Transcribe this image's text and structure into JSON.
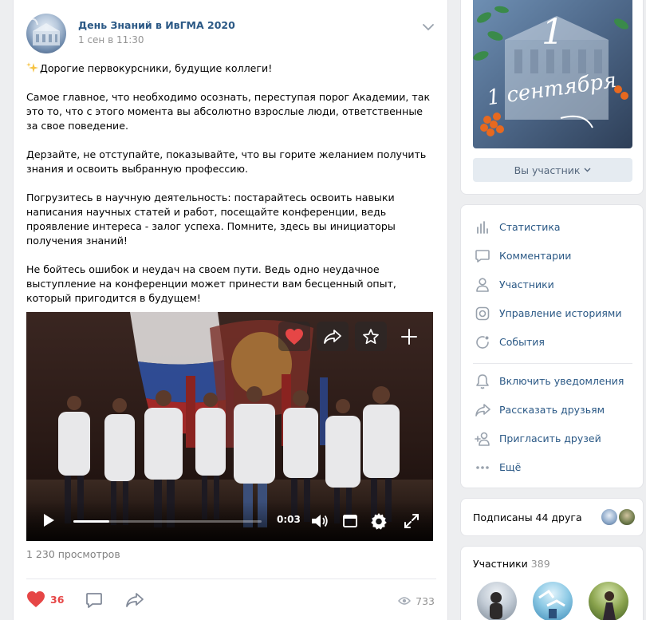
{
  "post": {
    "author": "День Знаний в ИвГМА 2020",
    "date": "1 сен в 11:30",
    "paragraphs": [
      "Дорогие первокурсники, будущие коллеги!",
      "Самое главное, что необходимо осознать, переступая порог Академии, так это то, что с этого момента вы абсолютно взрослые люди, ответственные за свое поведение.",
      "Дерзайте, не отступайте, показывайте, что вы горите желанием получить знания и освоить выбранную профессию.",
      "Погрузитесь в научную деятельность: постарайтесь освоить навыки написания научных статей и работ, посещайте конференции, ведь проявление интереса - залог успеха. Помните, здесь вы инициаторы получения знаний!",
      "Не бойтесь ошибок и неудач на своем пути. Ведь одно неудачное выступление на конференции может принести вам бесценный опыт, который пригодится в будущем!"
    ],
    "video": {
      "time": "0:03",
      "progress_fraction": 0.19
    },
    "views_label": "1 230 просмотров",
    "likes": "36",
    "views": "733",
    "colors": {
      "like": "#e64646",
      "link": "#2a5885"
    }
  },
  "sidebar": {
    "cover_text": "1 сентября",
    "member_button": "Вы участник",
    "menu": [
      {
        "label": "Статистика",
        "icon": "stats-icon"
      },
      {
        "label": "Комментарии",
        "icon": "comment-icon"
      },
      {
        "label": "Участники",
        "icon": "user-icon"
      },
      {
        "label": "Управление историями",
        "icon": "stories-icon"
      },
      {
        "label": "События",
        "icon": "event-icon"
      },
      {
        "label": "Включить уведомления",
        "icon": "bell-icon"
      },
      {
        "label": "Рассказать друзьям",
        "icon": "share-icon"
      },
      {
        "label": "Пригласить друзей",
        "icon": "add-user-icon"
      },
      {
        "label": "Ещё",
        "icon": "more-icon"
      }
    ],
    "friends_label": "Подписаны 44 друга",
    "members_title": "Участники",
    "members_count": "389"
  }
}
